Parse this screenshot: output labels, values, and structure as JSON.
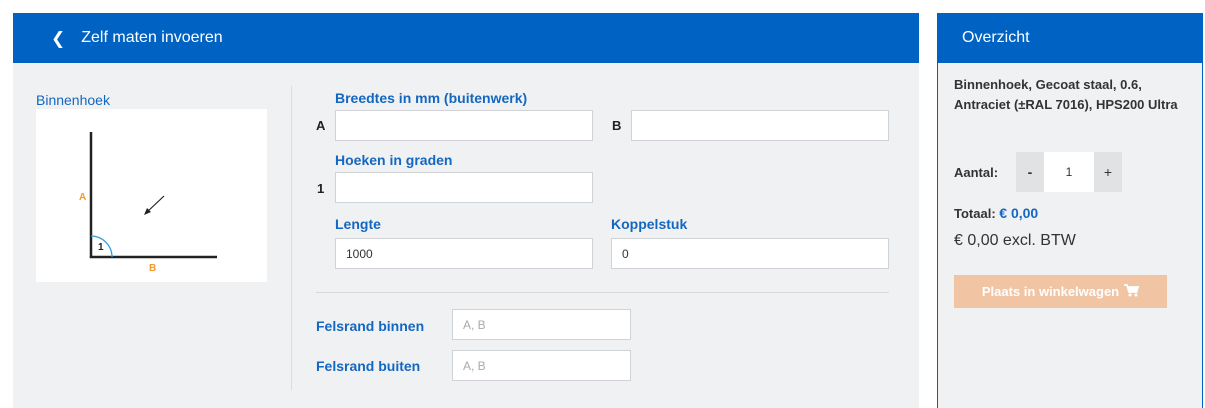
{
  "left_panel": {
    "title": "Zelf maten invoeren",
    "back_icon": "chevron-left-icon",
    "preview": {
      "label": "Binnenhoek",
      "label_a": "A",
      "label_b": "B",
      "angle_number": "1"
    },
    "widths": {
      "label": "Breedtes in mm (buitenwerk)",
      "a_marker": "A",
      "a_value": "",
      "b_marker": "B",
      "b_value": ""
    },
    "angles": {
      "label": "Hoeken in graden",
      "marker": "1",
      "value": ""
    },
    "length": {
      "label": "Lengte",
      "value": "1000"
    },
    "koppelstuk": {
      "label": "Koppelstuk",
      "value": "0"
    },
    "felsrand_binnen": {
      "label": "Felsrand binnen",
      "placeholder": "A, B"
    },
    "felsrand_buiten": {
      "label": "Felsrand buiten",
      "placeholder": "A, B"
    }
  },
  "overview": {
    "title": "Overzicht",
    "product": "Binnenhoek, Gecoat staal, 0.6, Antraciet (±RAL 7016), HPS200 Ultra",
    "quantity_label": "Aantal:",
    "quantity_minus": "-",
    "quantity_value": "1",
    "quantity_plus": "+",
    "total_label": "Totaal:",
    "total_value": "€ 0,00",
    "excl_text": "€ 0,00 excl. BTW",
    "cart_button": "Plaats in winkelwagen",
    "cart_icon": "shopping-cart-icon"
  },
  "colors": {
    "primary": "#0062c2",
    "label_blue": "#1467c0",
    "accent_orange": "#f39a2b",
    "angle_circle": "#2d9fd9",
    "button_disabled": "#f1c4a4",
    "panel_bg": "#f0f1f3"
  }
}
